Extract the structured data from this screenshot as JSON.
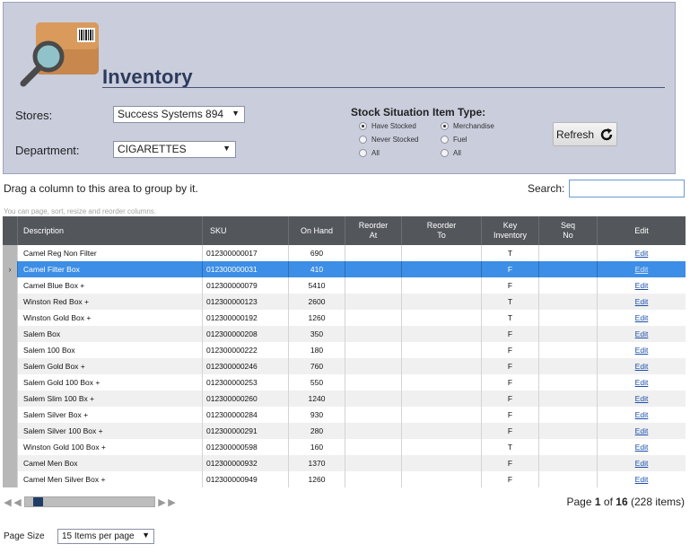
{
  "header": {
    "title": "Inventory",
    "logo_icon": "inventory-search-icon"
  },
  "filters": {
    "stores_label": "Stores:",
    "stores_value": "Success Systems 894",
    "department_label": "Department:",
    "department_value": "CIGARETTES",
    "stock_title": "Stock Situation",
    "stock_options": [
      "Have Stocked",
      "Never Stocked",
      "All"
    ],
    "stock_selected": 0,
    "item_title": "Item Type:",
    "item_options": [
      "Merchandise",
      "Fuel",
      "All"
    ],
    "item_selected": 0,
    "refresh_label": "Refresh"
  },
  "toolbar": {
    "group_hint": "Drag a column to this area to group by it.",
    "search_label": "Search:",
    "search_value": "",
    "small_hint": "You can page, sort, resize and reorder columns."
  },
  "grid": {
    "columns": [
      "Description",
      "SKU",
      "On Hand",
      "Reorder\nAt",
      "Reorder\nTo",
      "Key\nInventory",
      "Seq\nNo",
      "Edit"
    ],
    "selected_row": 1,
    "rows": [
      {
        "desc": "Camel Reg Non Filter",
        "sku": "012300000017",
        "on_hand": "690",
        "reorder_at": "",
        "reorder_to": "",
        "key": "T",
        "seq": "",
        "edit": "Edit"
      },
      {
        "desc": "Camel Filter Box",
        "sku": "012300000031",
        "on_hand": "410",
        "reorder_at": "",
        "reorder_to": "",
        "key": "F",
        "seq": "",
        "edit": "Edit"
      },
      {
        "desc": "Camel Blue Box +",
        "sku": "012300000079",
        "on_hand": "5410",
        "reorder_at": "",
        "reorder_to": "",
        "key": "F",
        "seq": "",
        "edit": "Edit"
      },
      {
        "desc": "Winston Red Box +",
        "sku": "012300000123",
        "on_hand": "2600",
        "reorder_at": "",
        "reorder_to": "",
        "key": "T",
        "seq": "",
        "edit": "Edit"
      },
      {
        "desc": "Winston Gold Box +",
        "sku": "012300000192",
        "on_hand": "1260",
        "reorder_at": "",
        "reorder_to": "",
        "key": "T",
        "seq": "",
        "edit": "Edit"
      },
      {
        "desc": "Salem Box",
        "sku": "012300000208",
        "on_hand": "350",
        "reorder_at": "",
        "reorder_to": "",
        "key": "F",
        "seq": "",
        "edit": "Edit"
      },
      {
        "desc": "Salem 100 Box",
        "sku": "012300000222",
        "on_hand": "180",
        "reorder_at": "",
        "reorder_to": "",
        "key": "F",
        "seq": "",
        "edit": "Edit"
      },
      {
        "desc": "Salem Gold Box +",
        "sku": "012300000246",
        "on_hand": "760",
        "reorder_at": "",
        "reorder_to": "",
        "key": "F",
        "seq": "",
        "edit": "Edit"
      },
      {
        "desc": "Salem Gold 100 Box +",
        "sku": "012300000253",
        "on_hand": "550",
        "reorder_at": "",
        "reorder_to": "",
        "key": "F",
        "seq": "",
        "edit": "Edit"
      },
      {
        "desc": "Salem Slim 100 Bx +",
        "sku": "012300000260",
        "on_hand": "1240",
        "reorder_at": "",
        "reorder_to": "",
        "key": "F",
        "seq": "",
        "edit": "Edit"
      },
      {
        "desc": "Salem Silver Box +",
        "sku": "012300000284",
        "on_hand": "930",
        "reorder_at": "",
        "reorder_to": "",
        "key": "F",
        "seq": "",
        "edit": "Edit"
      },
      {
        "desc": "Salem Silver 100 Box +",
        "sku": "012300000291",
        "on_hand": "280",
        "reorder_at": "",
        "reorder_to": "",
        "key": "F",
        "seq": "",
        "edit": "Edit"
      },
      {
        "desc": "Winston Gold 100 Box +",
        "sku": "012300000598",
        "on_hand": "160",
        "reorder_at": "",
        "reorder_to": "",
        "key": "T",
        "seq": "",
        "edit": "Edit"
      },
      {
        "desc": "Camel Men Box",
        "sku": "012300000932",
        "on_hand": "1370",
        "reorder_at": "",
        "reorder_to": "",
        "key": "F",
        "seq": "",
        "edit": "Edit"
      },
      {
        "desc": "Camel Men Silver Box +",
        "sku": "012300000949",
        "on_hand": "1260",
        "reorder_at": "",
        "reorder_to": "",
        "key": "F",
        "seq": "",
        "edit": "Edit"
      }
    ]
  },
  "pager": {
    "page_label": "Page",
    "current_page": "1",
    "of_label": "of",
    "total_pages": "16",
    "items_text": "(228 items)",
    "page_fraction": 0.0625,
    "page_size_label": "Page Size",
    "page_size_value": "15 Items per page"
  }
}
